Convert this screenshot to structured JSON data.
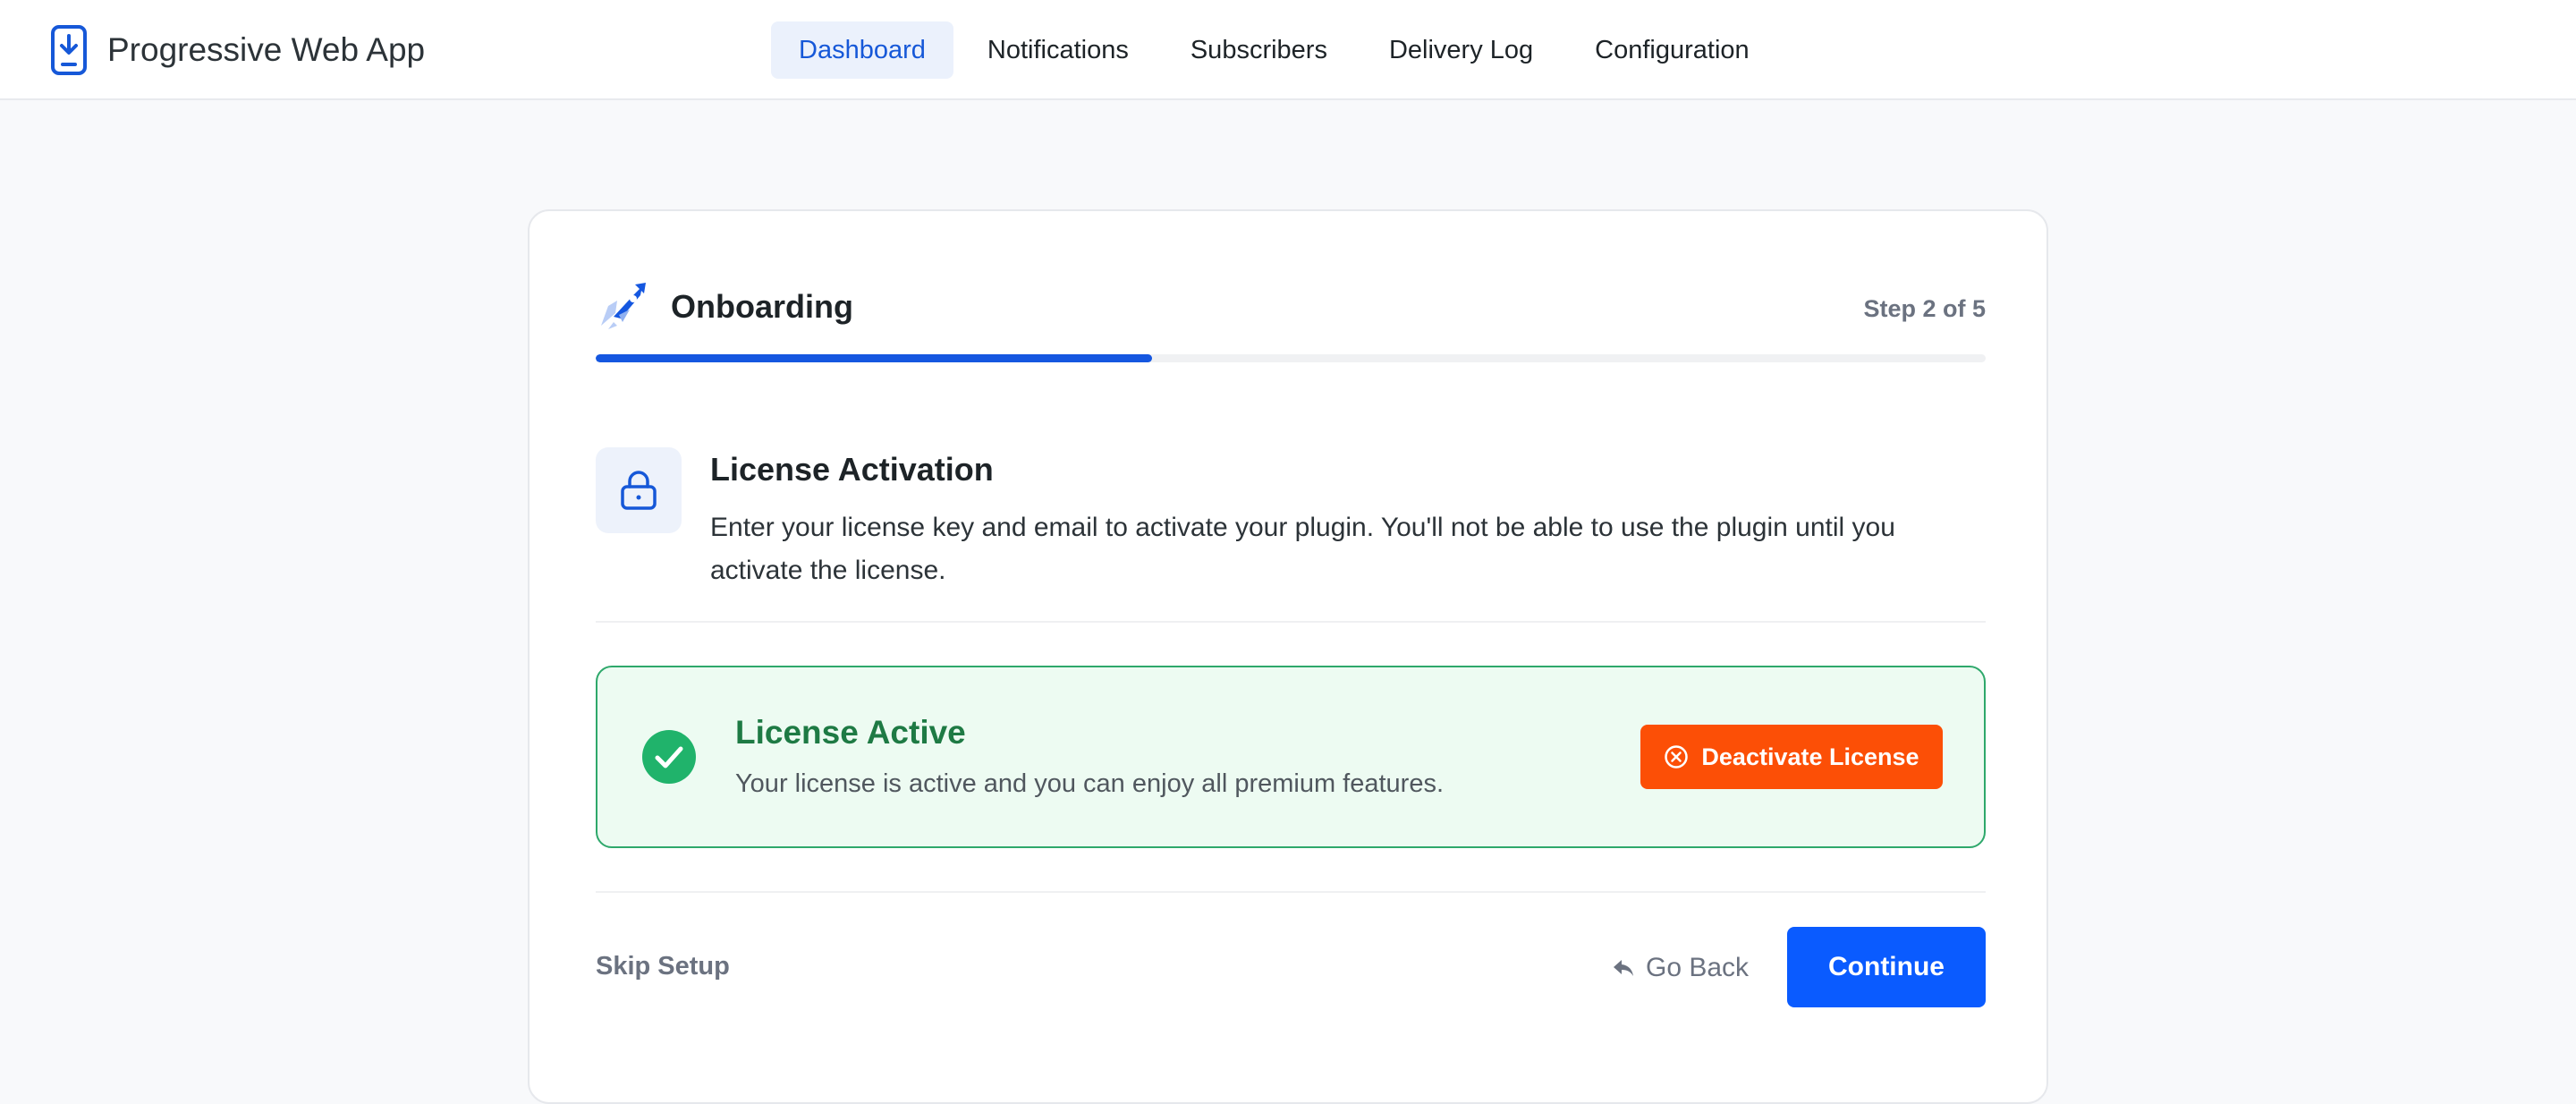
{
  "app": {
    "title": "Progressive Web App",
    "icon": "phone-download-icon"
  },
  "nav": {
    "items": [
      {
        "label": "Dashboard",
        "active": true
      },
      {
        "label": "Notifications",
        "active": false
      },
      {
        "label": "Subscribers",
        "active": false
      },
      {
        "label": "Delivery Log",
        "active": false
      },
      {
        "label": "Configuration",
        "active": false
      }
    ]
  },
  "onboarding": {
    "title": "Onboarding",
    "icon": "rocket-icon",
    "step_label": "Step 2 of 5",
    "progress_percent": 40
  },
  "section": {
    "icon": "lock-icon",
    "title": "License Activation",
    "description": "Enter your license key and email to activate your plugin. You'll not be able to use the plugin until you activate the license."
  },
  "license": {
    "status_icon": "check-circle-icon",
    "status_title": "License Active",
    "status_text": "Your license is active and you can enjoy all premium features.",
    "deactivate_label": "Deactivate License",
    "deactivate_icon": "x-circle-icon"
  },
  "footer": {
    "skip_label": "Skip Setup",
    "back_label": "Go Back",
    "back_icon": "reply-arrow-icon",
    "continue_label": "Continue"
  },
  "colors": {
    "primary": "#0a5bff",
    "progress": "#1557e0",
    "success": "#1e7a44",
    "success_bg": "#edfbf2",
    "danger": "#fc4f06"
  }
}
